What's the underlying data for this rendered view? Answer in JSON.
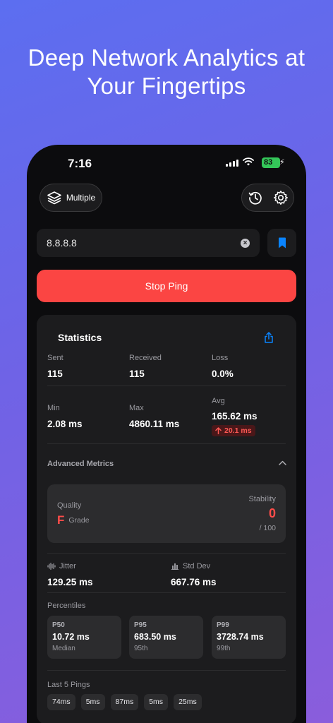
{
  "headline": {
    "line1": "Deep Network Analytics at",
    "line2": "Your Fingertips"
  },
  "status_bar": {
    "time": "7:16",
    "battery": "83"
  },
  "toolbar": {
    "mode_label": "Multiple"
  },
  "address": {
    "value": "8.8.8.8"
  },
  "actions": {
    "stop_label": "Stop Ping"
  },
  "statistics": {
    "title": "Statistics",
    "sent_label": "Sent",
    "sent": "115",
    "received_label": "Received",
    "received": "115",
    "loss_label": "Loss",
    "loss": "0.0%",
    "min_label": "Min",
    "min": "2.08 ms",
    "max_label": "Max",
    "max": "4860.11 ms",
    "avg_label": "Avg",
    "avg": "165.62 ms",
    "avg_delta": "20.1 ms"
  },
  "advanced": {
    "title": "Advanced Metrics",
    "quality_label": "Quality",
    "grade": "F",
    "grade_suffix": "Grade",
    "stability_label": "Stability",
    "stability": "0",
    "stability_of": "/ 100",
    "jitter_label": "Jitter",
    "jitter": "129.25 ms",
    "stddev_label": "Std Dev",
    "stddev": "667.76 ms",
    "percentiles_title": "Percentiles",
    "percentiles": [
      {
        "key": "P50",
        "value": "10.72 ms",
        "sub": "Median"
      },
      {
        "key": "P95",
        "value": "683.50 ms",
        "sub": "95th"
      },
      {
        "key": "P99",
        "value": "3728.74 ms",
        "sub": "99th"
      }
    ],
    "last_pings_title": "Last 5 Pings",
    "last_pings": [
      "74ms",
      "5ms",
      "87ms",
      "5ms",
      "25ms"
    ]
  },
  "colors": {
    "accent_red": "#fb4543",
    "bookmark_blue": "#0a84ff",
    "battery_green": "#34c759"
  },
  "icons": [
    "layers-icon",
    "history-icon",
    "gear-icon",
    "clear-icon",
    "bookmark-icon",
    "share-icon",
    "chevron-up-icon",
    "waveform-icon",
    "bar-chart-icon",
    "arrow-up-icon"
  ]
}
